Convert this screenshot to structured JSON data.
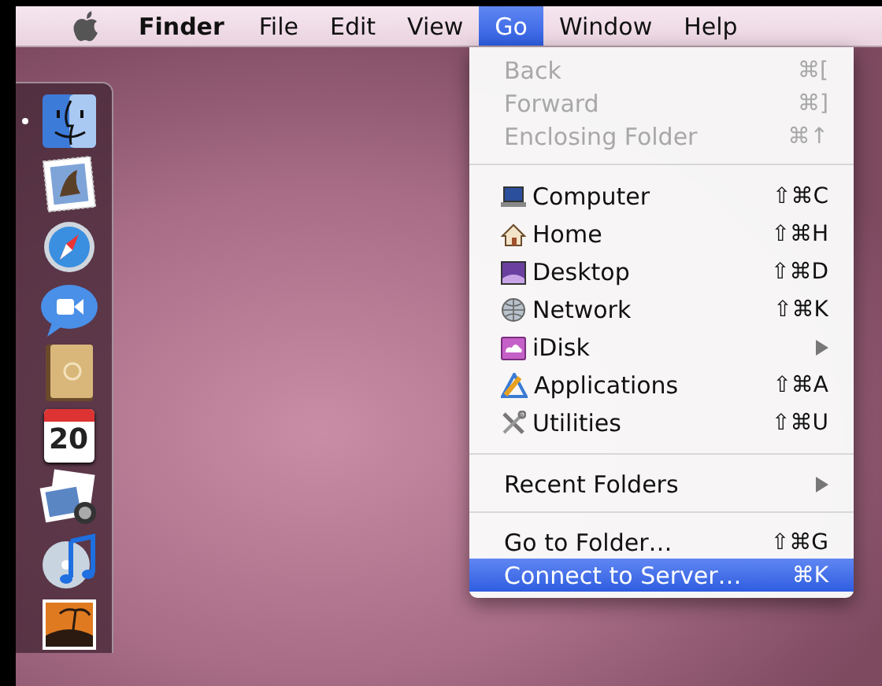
{
  "menu_bar": {
    "app_name": "Finder",
    "menus": [
      {
        "label": "File",
        "selected": false
      },
      {
        "label": "Edit",
        "selected": false
      },
      {
        "label": "View",
        "selected": false
      },
      {
        "label": "Go",
        "selected": true
      },
      {
        "label": "Window",
        "selected": false
      },
      {
        "label": "Help",
        "selected": false
      }
    ]
  },
  "go_menu": {
    "sections": [
      [
        {
          "label": "Back",
          "shortcut": "⌘[",
          "disabled": true,
          "selected": false
        },
        {
          "label": "Forward",
          "shortcut": "⌘]",
          "disabled": true,
          "selected": false
        },
        {
          "label": "Enclosing Folder",
          "shortcut": "⌘↑",
          "disabled": true,
          "selected": false
        }
      ],
      [
        {
          "label": "Computer",
          "shortcut": "⇧⌘C",
          "disabled": false,
          "selected": false,
          "kind": "laptop"
        },
        {
          "label": "Home",
          "shortcut": "⇧⌘H",
          "disabled": false,
          "selected": false,
          "kind": "house"
        },
        {
          "label": "Desktop",
          "shortcut": "⇧⌘D",
          "disabled": false,
          "selected": false,
          "kind": "screen"
        },
        {
          "label": "Network",
          "shortcut": "⇧⌘K",
          "disabled": false,
          "selected": false,
          "kind": "globe"
        },
        {
          "label": "iDisk",
          "submenu": true,
          "disabled": false,
          "selected": false,
          "kind": "disk"
        },
        {
          "label": "Applications",
          "shortcut": "⇧⌘A",
          "disabled": false,
          "selected": false,
          "kind": "apps"
        },
        {
          "label": "Utilities",
          "shortcut": "⇧⌘U",
          "disabled": false,
          "selected": false,
          "kind": "tools"
        }
      ],
      [
        {
          "label": "Recent Folders",
          "submenu": true,
          "disabled": false,
          "selected": false
        }
      ],
      [
        {
          "label": "Go to Folder…",
          "shortcut": "⇧⌘G",
          "disabled": false,
          "selected": false
        },
        {
          "label": "Connect to Server…",
          "shortcut": "⌘K",
          "disabled": false,
          "selected": true
        }
      ]
    ]
  },
  "dock": {
    "items": [
      {
        "kind": "finder",
        "running": true
      },
      {
        "kind": "stamp",
        "running": false
      },
      {
        "kind": "compass",
        "running": false
      },
      {
        "kind": "speech",
        "running": false
      },
      {
        "kind": "book",
        "running": false
      },
      {
        "kind": "calendar",
        "running": false,
        "date": "20"
      },
      {
        "kind": "photos",
        "running": false
      },
      {
        "kind": "music",
        "running": false
      },
      {
        "kind": "picture",
        "running": false
      }
    ]
  }
}
